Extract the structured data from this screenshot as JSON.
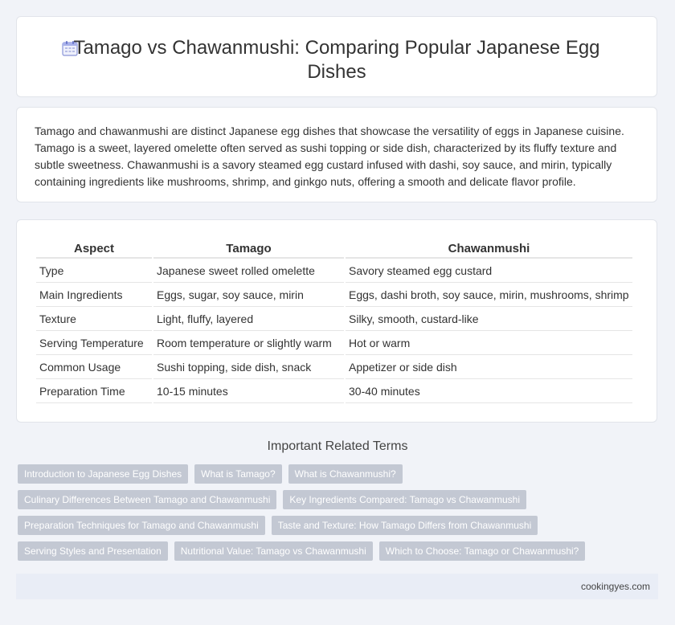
{
  "header": {
    "title": "Tamago vs Chawanmushi: Comparing Popular Japanese Egg Dishes",
    "icon": "calendar-icon"
  },
  "intro": {
    "text": "Tamago and chawanmushi are distinct Japanese egg dishes that showcase the versatility of eggs in Japanese cuisine. Tamago is a sweet, layered omelette often served as sushi topping or side dish, characterized by its fluffy texture and subtle sweetness. Chawanmushi is a savory steamed egg custard infused with dashi, soy sauce, and mirin, typically containing ingredients like mushrooms, shrimp, and ginkgo nuts, offering a smooth and delicate flavor profile."
  },
  "table": {
    "headers": [
      "Aspect",
      "Tamago",
      "Chawanmushi"
    ],
    "rows": [
      [
        "Type",
        "Japanese sweet rolled omelette",
        "Savory steamed egg custard"
      ],
      [
        "Main Ingredients",
        "Eggs, sugar, soy sauce, mirin",
        "Eggs, dashi broth, soy sauce, mirin, mushrooms, shrimp"
      ],
      [
        "Texture",
        "Light, fluffy, layered",
        "Silky, smooth, custard-like"
      ],
      [
        "Serving Temperature",
        "Room temperature or slightly warm",
        "Hot or warm"
      ],
      [
        "Common Usage",
        "Sushi topping, side dish, snack",
        "Appetizer or side dish"
      ],
      [
        "Preparation Time",
        "10-15 minutes",
        "30-40 minutes"
      ]
    ]
  },
  "related": {
    "title": "Important Related Terms",
    "tags": [
      [
        "Introduction to Japanese Egg Dishes",
        "What is Tamago?",
        "What is Chawanmushi?"
      ],
      [
        "Culinary Differences Between Tamago and Chawanmushi",
        "Key Ingredients Compared: Tamago vs Chawanmushi"
      ],
      [
        "Preparation Techniques for Tamago and Chawanmushi",
        "Taste and Texture: How Tamago Differs from Chawanmushi"
      ],
      [
        "Serving Styles and Presentation",
        "Nutritional Value: Tamago vs Chawanmushi",
        "Which to Choose: Tamago or Chawanmushi?"
      ]
    ]
  },
  "footer": {
    "site": "cookingyes.com"
  },
  "colors": {
    "tag_bg": "#c3c8d3",
    "page_bg": "#f1f3f8",
    "footer_bg": "#e9edf6"
  }
}
